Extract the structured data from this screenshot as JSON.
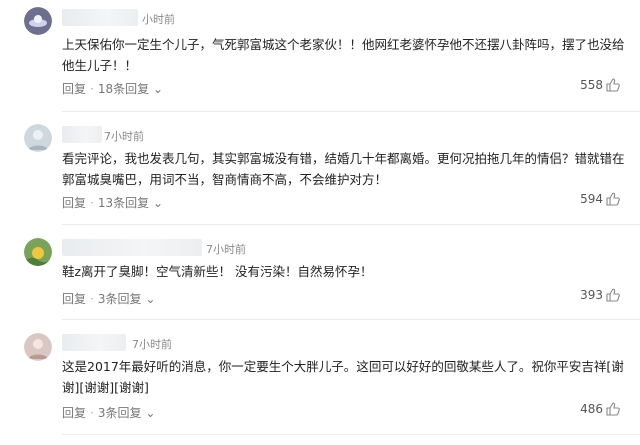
{
  "comments": [
    {
      "time": "小时前",
      "text": "上天保佑你一定生个儿子，气死郭富城这个老家伙！！他网红老婆怀孕他不还摆八卦阵吗，摆了也没给他生儿子！！",
      "reply_label": "回复",
      "replies": "18条回复",
      "likes": "558"
    },
    {
      "time": "7小时前",
      "text": "看完评论，我也发表几句，其实郭富城没有错，结婚几十年都离婚。更何况拍拖几年的情侣？错就错在郭富城臭嘴巴，用词不当，智商情商不高，不会维护对方！",
      "reply_label": "回复",
      "replies": "13条回复",
      "likes": "594"
    },
    {
      "time": "7小时前",
      "text": "鞋z离开了臭脚！空气清新些！ 没有污染！自然易怀孕！",
      "reply_label": "回复",
      "replies": "3条回复",
      "likes": "393"
    },
    {
      "time": "7小时前",
      "text": "这是2017年最好听的消息，你一定要生个大胖儿子。这回可以好好的回敬某些人了。祝你平安吉祥[谢谢][谢谢][谢谢]",
      "reply_label": "回复",
      "replies": "3条回复",
      "likes": "486"
    }
  ],
  "icons": {
    "reply_arrow": "chevron-down-icon",
    "like": "thumbs-up-icon"
  },
  "colors": {
    "text": "#222222",
    "meta": "#777777",
    "divider": "#ececec"
  }
}
